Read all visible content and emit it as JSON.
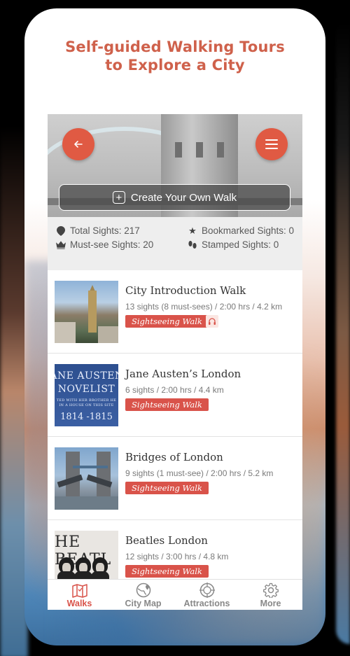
{
  "headline": {
    "line1": "Self-guided Walking Tours",
    "line2": "to Explore a City"
  },
  "hero": {
    "create_walk_label": "Create Your Own Walk",
    "back_icon": "arrow-left-icon",
    "menu_icon": "hamburger-menu-icon"
  },
  "stats": {
    "total_sights": "Total Sights: 217",
    "must_see_sights": "Must-see Sights: 20",
    "bookmarked_sights": "Bookmarked Sights: 0",
    "stamped_sights": "Stamped Sights: 0"
  },
  "walks": [
    {
      "title": "City Introduction Walk",
      "meta": "13 sights (8 must-sees) / 2:00 hrs / 4.2 km",
      "tag": "Sightseeing Walk",
      "has_audio": true,
      "thumb_icon": "big-ben-photo"
    },
    {
      "title": "Jane Austen’s London",
      "meta": "6 sights / 2:00 hrs / 4.4 km",
      "tag": "Sightseeing Walk",
      "has_audio": false,
      "thumb_icon": "blue-plaque-photo",
      "thumb_text": {
        "line1": "ANE AUSTEN",
        "line2": "NOVELIST",
        "small1": "TED WITH HER BROTHER HE",
        "small2": "IN A HOUSE ON THIS SITE",
        "years": "1814 -1815"
      }
    },
    {
      "title": "Bridges of London",
      "meta": "9 sights (1 must-see) / 2:00 hrs / 5.2 km",
      "tag": "Sightseeing Walk",
      "has_audio": false,
      "thumb_icon": "tower-bridge-photo"
    },
    {
      "title": "Beatles London",
      "meta": "12 sights / 3:00 hrs / 4.8 km",
      "tag": "Sightseeing Walk",
      "has_audio": false,
      "thumb_icon": "beatles-photo",
      "thumb_text": {
        "word": "HE BEATL"
      }
    }
  ],
  "nav": [
    {
      "label": "Walks",
      "icon": "map-icon",
      "active": true
    },
    {
      "label": "City Map",
      "icon": "globe-pin-icon",
      "active": false
    },
    {
      "label": "Attractions",
      "icon": "compass-target-icon",
      "active": false
    },
    {
      "label": "More",
      "icon": "gear-icon",
      "active": false
    }
  ],
  "colors": {
    "accent": "#d9534a",
    "headline": "#cf614b"
  }
}
